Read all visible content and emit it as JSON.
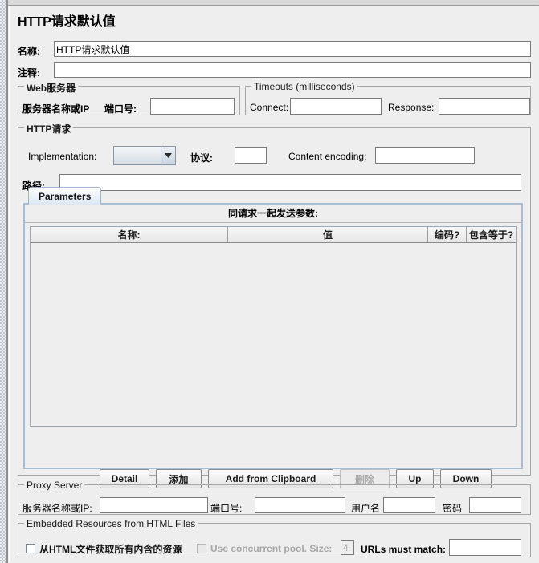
{
  "window": {
    "title": "HTTP请求默认值"
  },
  "name_row": {
    "label": "名称:",
    "value": "HTTP请求默认值"
  },
  "comment_row": {
    "label": "注释:",
    "value": ""
  },
  "web_server": {
    "title": "Web服务器",
    "server_label": "服务器名称或IP",
    "port_label": "端口号:",
    "server_value": "",
    "port_value": ""
  },
  "timeouts": {
    "title": "Timeouts (milliseconds)",
    "connect_label": "Connect:",
    "connect_value": "",
    "response_label": "Response:",
    "response_value": ""
  },
  "http_request": {
    "title": "HTTP请求",
    "implementation_label": "Implementation:",
    "implementation_value": "",
    "protocol_label": "协议:",
    "protocol_value": "",
    "content_encoding_label": "Content encoding:",
    "content_encoding_value": "",
    "path_label": "路径:",
    "path_value": ""
  },
  "tabs": [
    {
      "label": "Parameters",
      "selected": true
    }
  ],
  "parameters_panel": {
    "caption": "同请求一起发送参数:",
    "columns": [
      "名称:",
      "值",
      "编码?",
      "包含等于?"
    ],
    "rows": [],
    "buttons": [
      {
        "label": "Detail",
        "enabled": true
      },
      {
        "label": "添加",
        "enabled": true
      },
      {
        "label": "Add from Clipboard",
        "enabled": true
      },
      {
        "label": "删除",
        "enabled": false
      },
      {
        "label": "Up",
        "enabled": true
      },
      {
        "label": "Down",
        "enabled": true
      }
    ]
  },
  "proxy_server": {
    "title": "Proxy Server",
    "server_label": "服务器名称或IP:",
    "server_value": "",
    "port_label": "端口号:",
    "port_value": "",
    "username_label": "用户名",
    "username_value": "",
    "password_label": "密码",
    "password_value": ""
  },
  "embedded_resources": {
    "title": "Embedded Resources from HTML Files",
    "retrieve_label": "从HTML文件获取所有内含的资源",
    "retrieve_checked": false,
    "concurrent_label": "Use concurrent pool. Size:",
    "concurrent_checked": false,
    "concurrent_enabled": false,
    "pool_size_value": "4",
    "urls_match_label": "URLs must match:",
    "urls_match_value": ""
  },
  "icons": {
    "combo_arrow": "chevron-down-icon"
  },
  "colors": {
    "panel_bg": "#eeeeee",
    "field_bg": "#ffffff",
    "border": "#a6a6a6",
    "tab_border": "#a9bed4",
    "disabled_text": "#a9a9a9"
  }
}
